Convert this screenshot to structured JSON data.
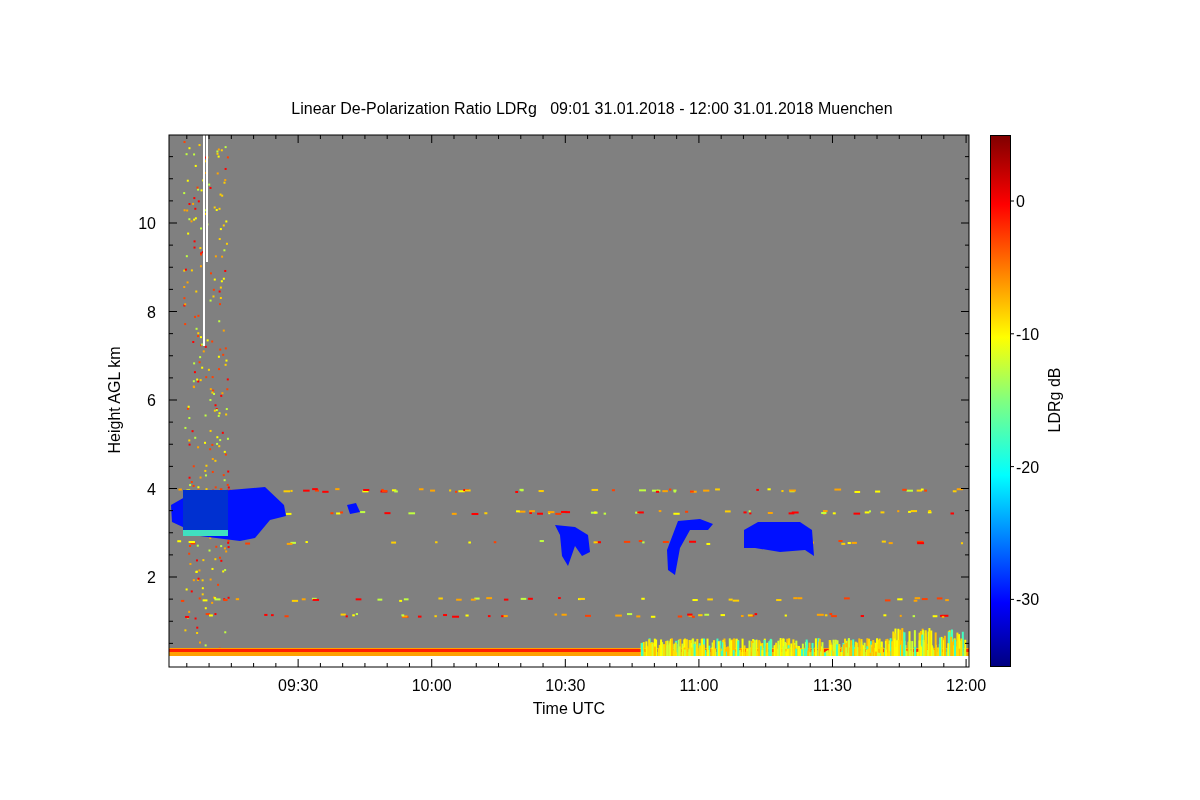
{
  "plot": {
    "title": "Linear De-Polarization Ratio LDRg   09:01 31.01.2018 - 12:00 31.01.2018 Muenchen",
    "xlabel": "Time UTC",
    "ylabel": "Height AGL km",
    "xticks": [
      "09:30",
      "10:00",
      "10:30",
      "11:00",
      "11:30",
      "12:00"
    ],
    "yticks": [
      "10",
      "8",
      "6",
      "4",
      "2"
    ],
    "colorbar": {
      "label": "LDRg dB",
      "ticks": [
        "0",
        "-10",
        "-20",
        "-30"
      ]
    }
  }
}
